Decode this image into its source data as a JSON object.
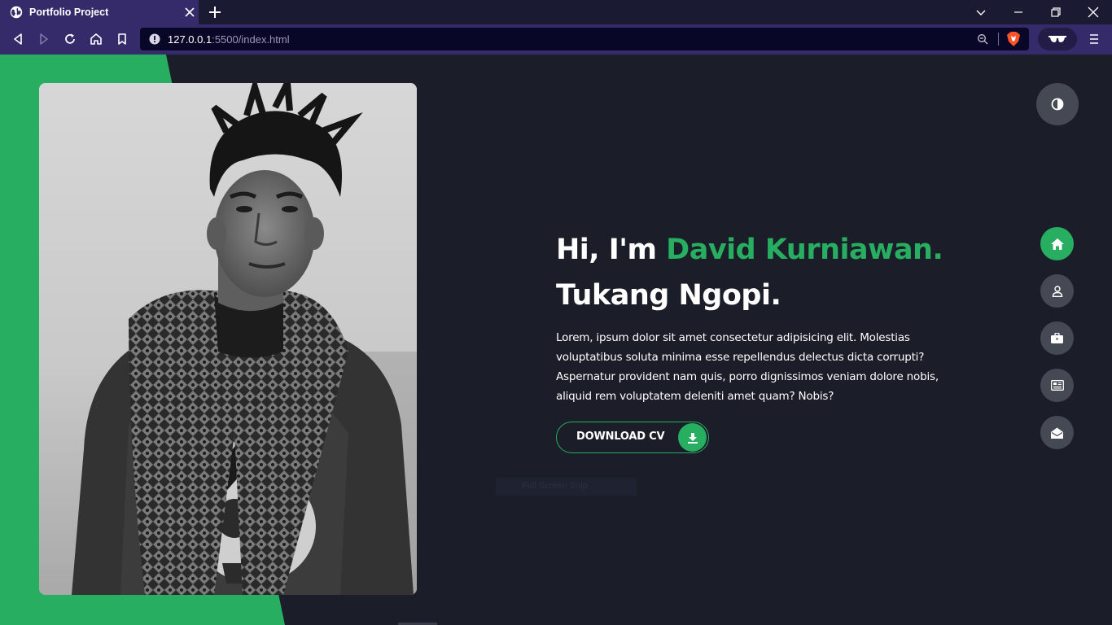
{
  "browser": {
    "tab_title": "Portfolio Project",
    "url_host": "127.0.0.1",
    "url_rest": ":5500/index.html"
  },
  "hero": {
    "greeting": "Hi, I'm ",
    "name": "David Kurniawan.",
    "role": "Tukang Ngopi.",
    "description": "Lorem, ipsum dolor sit amet consectetur adipisicing elit. Molestias voluptatibus soluta minima esse repellendus delectus dicta corrupti? Aspernatur provident nam quis, porro dignissimos veniam dolore nobis, aliquid rem voluptatem deleniti amet quam? Nobis?",
    "cv_button": "DOWNLOAD CV"
  },
  "overlay": {
    "ghost_text": "Full Screen Snip"
  },
  "colors": {
    "accent": "#27ae60",
    "page_bg": "#1b1d29",
    "nav_button": "#454954",
    "browser_frame": "#352b6a"
  },
  "side_nav": [
    {
      "name": "home",
      "icon": "home-icon",
      "active": true
    },
    {
      "name": "about",
      "icon": "user-icon",
      "active": false
    },
    {
      "name": "portfolio",
      "icon": "briefcase-icon",
      "active": false
    },
    {
      "name": "blog",
      "icon": "newspaper-icon",
      "active": false
    },
    {
      "name": "contact",
      "icon": "envelope-icon",
      "active": false
    }
  ]
}
